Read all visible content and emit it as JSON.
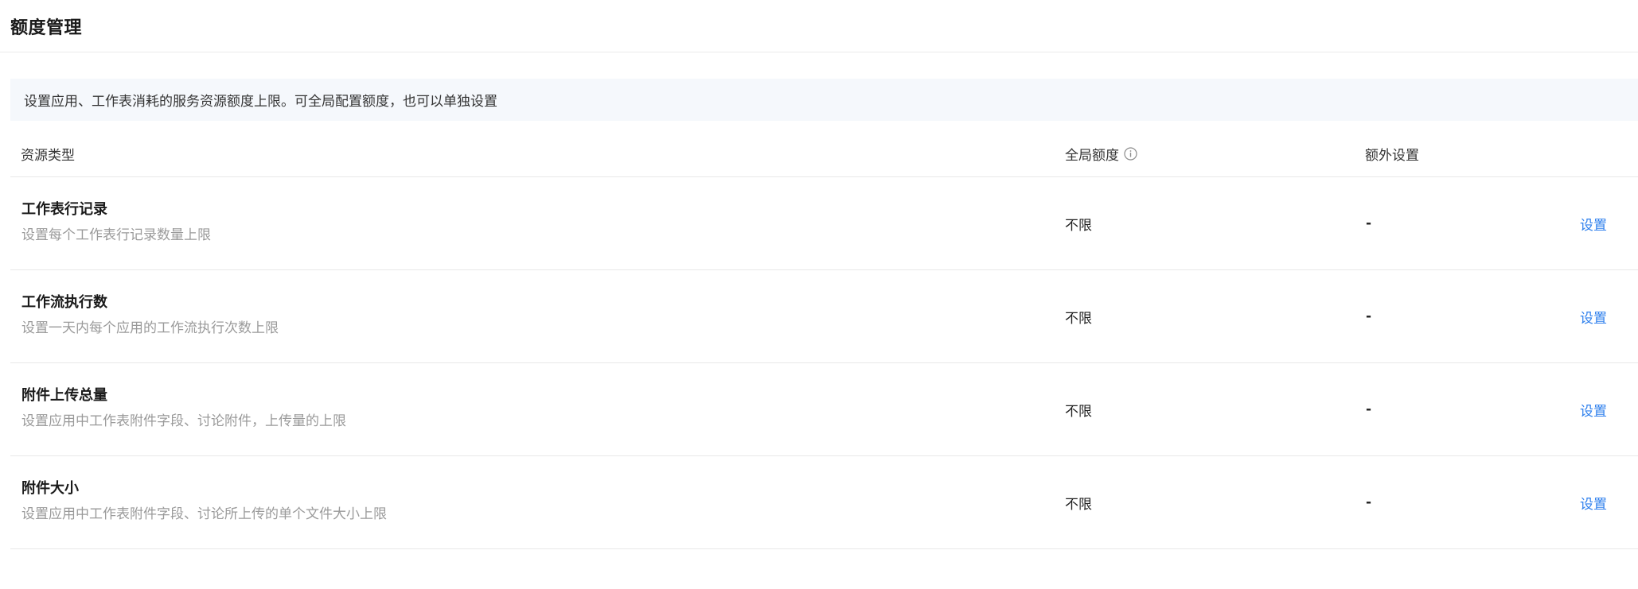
{
  "page": {
    "title": "额度管理",
    "notice": "设置应用、工作表消耗的服务资源额度上限。可全局配置额度，也可以单独设置"
  },
  "table": {
    "headers": {
      "type": "资源类型",
      "global": "全局额度",
      "extra": "额外设置"
    },
    "rows": [
      {
        "title": "工作表行记录",
        "desc": "设置每个工作表行记录数量上限",
        "global": "不限",
        "extra": "-",
        "action": "设置"
      },
      {
        "title": "工作流执行数",
        "desc": "设置一天内每个应用的工作流执行次数上限",
        "global": "不限",
        "extra": "-",
        "action": "设置"
      },
      {
        "title": "附件上传总量",
        "desc": "设置应用中工作表附件字段、讨论附件，上传量的上限",
        "global": "不限",
        "extra": "-",
        "action": "设置"
      },
      {
        "title": "附件大小",
        "desc": "设置应用中工作表附件字段、讨论所上传的单个文件大小上限",
        "global": "不限",
        "extra": "-",
        "action": "设置"
      }
    ]
  },
  "icons": {
    "info": "info-circle-icon"
  },
  "colors": {
    "link": "#2f80ed",
    "notice_bg": "#f5f8fc",
    "muted_text": "#9a9a9a"
  }
}
